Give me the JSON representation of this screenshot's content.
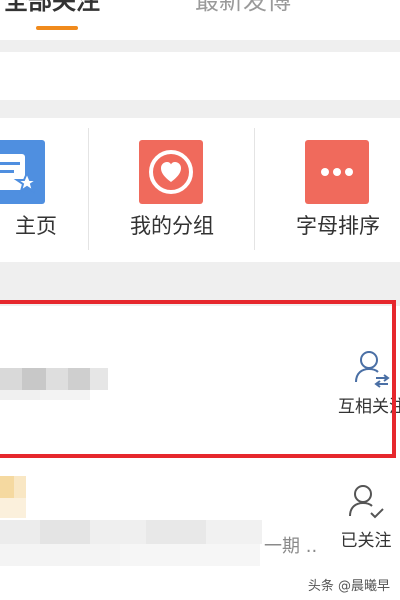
{
  "tabs": {
    "all_following": "全部关注",
    "latest_posts": "最新发博"
  },
  "quick_entries": [
    {
      "label": "主页",
      "icon": "bookmark-star-icon",
      "color": "#4f8fe0"
    },
    {
      "label": "我的分组",
      "icon": "heart-circle-icon",
      "color": "#f06a5c"
    },
    {
      "label": "字母排序",
      "icon": "more-dots-icon",
      "color": "#f06a5c"
    }
  ],
  "follow_rows": [
    {
      "status": "互相关注",
      "icon": "mutual-follow-icon",
      "highlighted": true
    },
    {
      "status": "已关注",
      "snippet": "一期 ..",
      "icon": "following-icon",
      "highlighted": false
    }
  ],
  "watermark": "头条 @晨曦早",
  "colors": {
    "accent": "#f08a1c",
    "highlight": "#e6272d",
    "blue_tile": "#4f8fe0",
    "red_tile": "#f06a5c"
  }
}
